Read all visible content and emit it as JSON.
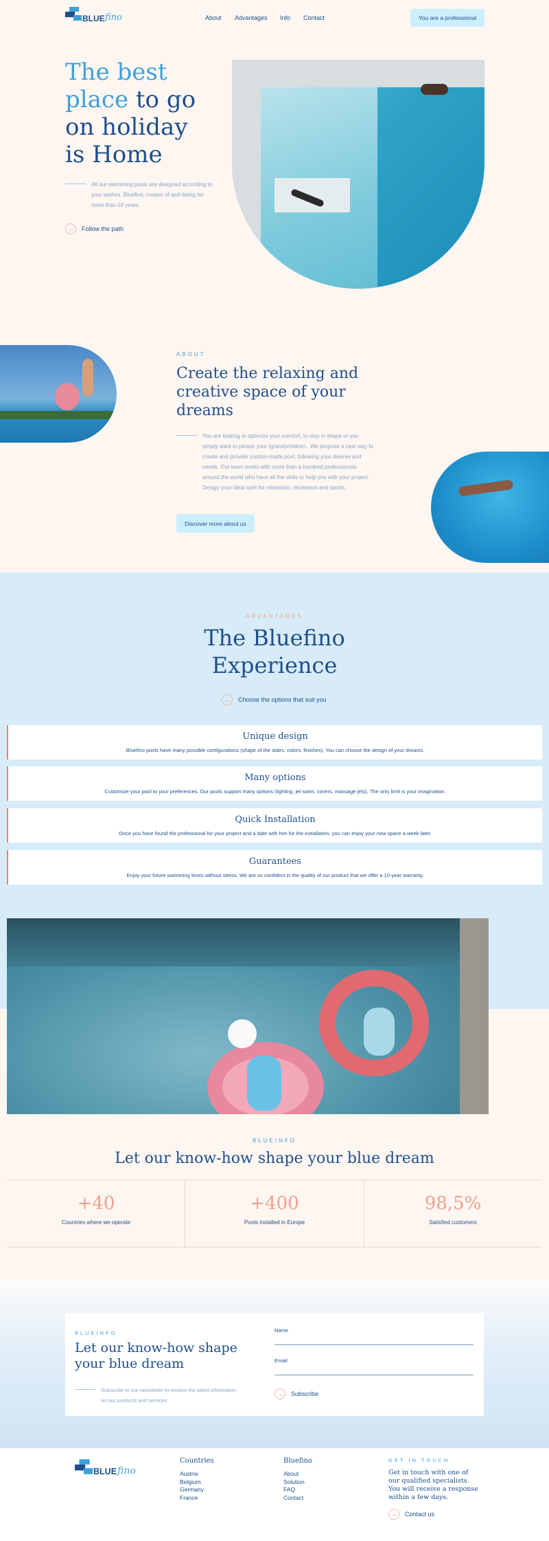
{
  "nav": {
    "logo_main": "BLUE",
    "logo_script": "fino",
    "links": [
      "About",
      "Advantages",
      "Info",
      "Contact"
    ],
    "cta": "You are a professional"
  },
  "hero": {
    "title_light_1": "The best",
    "title_light_2": "place",
    "title_dark_1": " to go",
    "title_dark_2": "on holiday",
    "title_dark_3": "is Home",
    "description": "All our swimming pools are designed according to your wishes. Bluefino, creator of well-being for more than 50 years.",
    "link": "Follow the path"
  },
  "about": {
    "eyebrow": "ABOUT",
    "title": "Create the relaxing and creative space of your dreams",
    "body": "You are looking to optimize your comfort, to stay in shape or you simply want to please your (grand)children.. We propose a new way to create and provide custom-made pool, following your desires and needs. Our team works with more than a hundred professionals around the world who have all the skills to help you with your project. Design your ideal spot for relaxation, recreation and sports.",
    "button": "Discover more about us"
  },
  "advantages": {
    "eyebrow": "ADVANTAGES",
    "title_1": "The Bluefino",
    "title_2": "Experience",
    "link": "Choose the options that suit you",
    "items": [
      {
        "title": "Unique design",
        "text": "Bluefino pools have many possible configurations (shape of the stairs, colors, finishes). You can choose the design of your dreams."
      },
      {
        "title": "Many options",
        "text": "Customize your pool to your preferences. Our pools support many options (lighting, jet swim, covers, massage jets). The only limit is your imagination."
      },
      {
        "title": "Quick Installation",
        "text": "Once you have found the professional for your project and a date with him for the installation, you can enjoy your new space a week later."
      },
      {
        "title": "Guarantees",
        "text": "Enjoy your future swimming times without stress. We are so confident in the quality of our product that we offer a 10-year warranty."
      }
    ]
  },
  "blueinfo": {
    "eyebrow": "BLUEINFO",
    "title": "Let our know-how shape your blue dream",
    "stats": [
      {
        "number": "+40",
        "label": "Countries where we operate"
      },
      {
        "number": "+400",
        "label": "Pools installed in Europe"
      },
      {
        "number": "98,5%",
        "label": "Satisfied customers"
      }
    ]
  },
  "newsletter": {
    "eyebrow": "BLUEINFO",
    "title": "Let our know-how shape your blue dream",
    "text": "Subscribe to our newsletter to receive the latest information on our products and services",
    "name_label": "Name",
    "email_label": "Email",
    "button": "Subscribe"
  },
  "footer": {
    "countries_title": "Countries",
    "countries": [
      "Austria",
      "Belgium",
      "Germany",
      "France"
    ],
    "bluefino_title": "Bluefino",
    "bluefino_links": [
      "About",
      "Solution",
      "FAQ",
      "Contact"
    ],
    "contact_eyebrow": "GET IN TOUCH",
    "contact_text": "Get in touch with one of our qualified specialists. You will receive a response within a few days.",
    "contact_link": "Contact us"
  },
  "colors": {
    "navy": "#1f4e8c",
    "light_blue": "#3fa0d8",
    "coral": "#e8826f",
    "cream": "#fdf6f1",
    "pale_blue": "#d7ecf8"
  }
}
